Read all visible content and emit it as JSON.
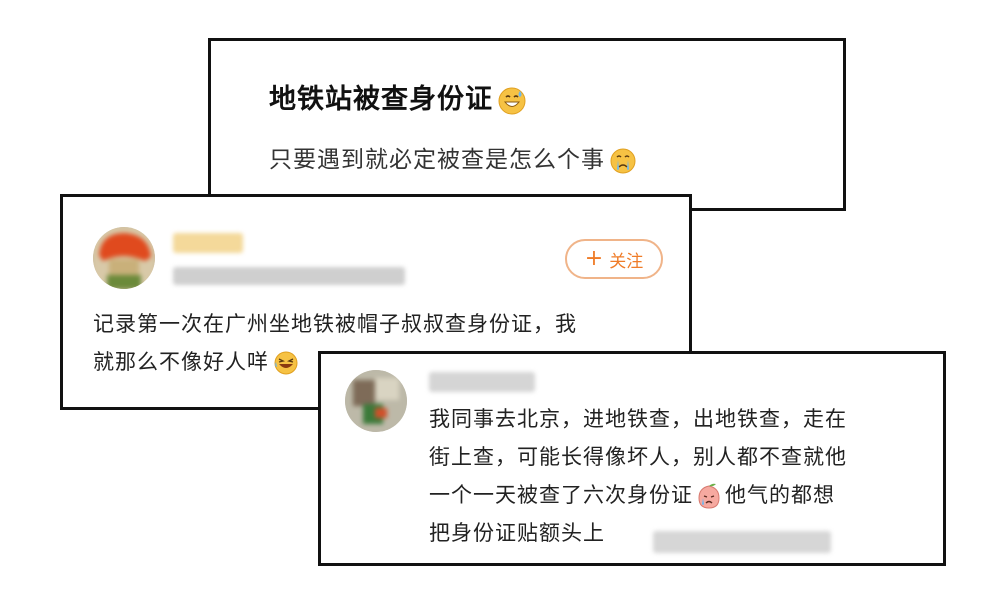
{
  "question": {
    "title": "地铁站被查身份证",
    "title_emoji": "grinning-sweat-emoji",
    "subtitle": "只要遇到就必定被查是怎么个事",
    "subtitle_emoji": "crying-emoji"
  },
  "comment1": {
    "follow_label": "关注",
    "follow_icon": "plus-icon",
    "lines": [
      "记录第一次在广州坐地铁被帽子叔叔查身份证，我",
      "就那么不像好人咩"
    ],
    "line2_emoji": "laughing-crying-emoji",
    "accent_color": "#ef7c28"
  },
  "comment2": {
    "lines": [
      "我同事去北京，进地铁查，出地铁查，走在",
      "街上查，可能长得像坏人，别人都不查就他",
      "一个一天被查了六次身份证",
      "他气的都想",
      "把身份证贴额头上"
    ],
    "line3_emoji": "peach-crying-emoji"
  }
}
